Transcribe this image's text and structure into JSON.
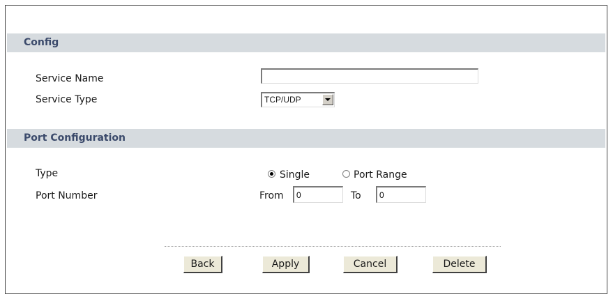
{
  "config": {
    "header": "Config",
    "service_name_label": "Service Name",
    "service_name_value": "",
    "service_type_label": "Service Type",
    "service_type_value": "TCP/UDP"
  },
  "port_config": {
    "header": "Port Configuration",
    "type_label": "Type",
    "type_options": [
      "Single",
      "Port Range"
    ],
    "type_selected": "Single",
    "port_number_label": "Port Number",
    "from_label": "From",
    "from_value": "0",
    "to_label": "To",
    "to_value": "0"
  },
  "buttons": {
    "back": "Back",
    "apply": "Apply",
    "cancel": "Cancel",
    "delete": "Delete"
  }
}
